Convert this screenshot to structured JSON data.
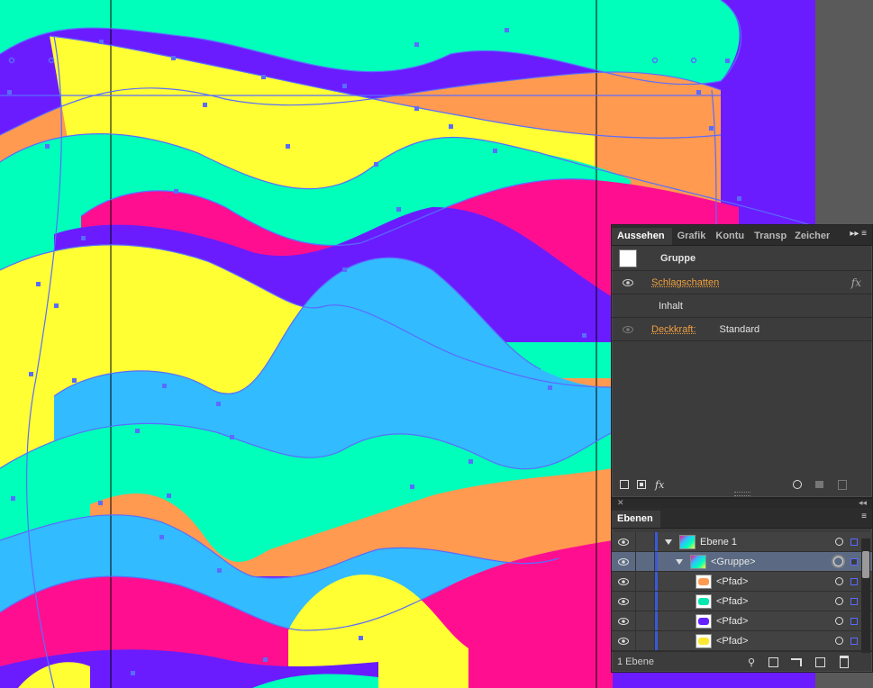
{
  "appearance_panel": {
    "tabs": [
      "Aussehen",
      "Grafik",
      "Kontu",
      "Transp",
      "Zeichen"
    ],
    "object_type": "Gruppe",
    "effect": "Schlagschatten",
    "fx_label": "fx",
    "content_label": "Inhalt",
    "opacity_label": "Deckkraft:",
    "opacity_value": "Standard",
    "footer_fx": "fx"
  },
  "layers_panel": {
    "tab": "Ebenen",
    "rows": [
      {
        "name": "Ebene 1",
        "level": 0,
        "expanded": true
      },
      {
        "name": "<Gruppe>",
        "level": 1,
        "expanded": true,
        "selected": true
      },
      {
        "name": "<Pfad>",
        "level": 2,
        "swatch": "#ff9a50"
      },
      {
        "name": "<Pfad>",
        "level": 2,
        "swatch": "#00e8b0"
      },
      {
        "name": "<Pfad>",
        "level": 2,
        "swatch": "#6620ff"
      },
      {
        "name": "<Pfad>",
        "level": 2,
        "swatch": "#ffe830"
      }
    ],
    "status": "1 Ebene"
  },
  "colors": {
    "purple": "#6a1cff",
    "mint": "#00ffbb",
    "yellow": "#ffff33",
    "orange": "#ff9a50",
    "pink": "#ff0f90",
    "sky": "#33bbff",
    "guide": "#5a6cff",
    "artboard_bg": "#5a5a5a"
  }
}
